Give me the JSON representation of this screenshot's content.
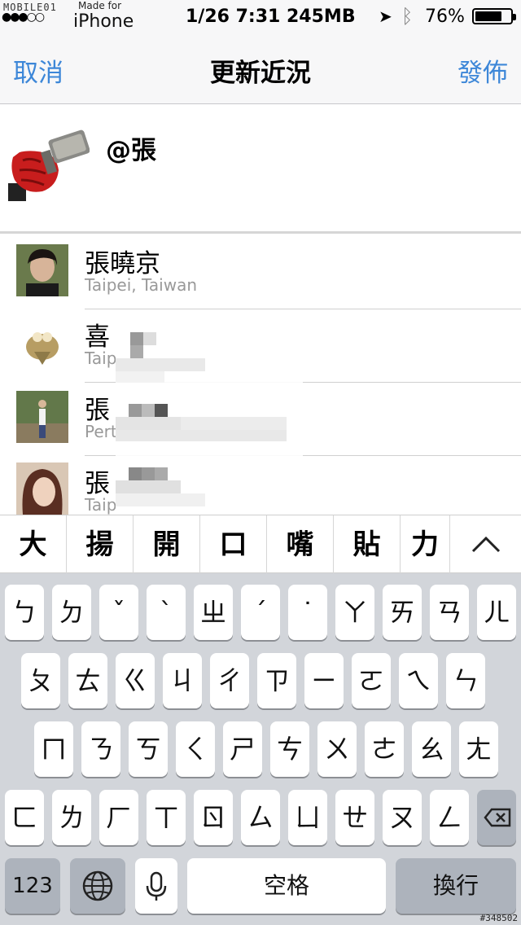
{
  "status_bar": {
    "logo": "MOBILE01",
    "made_for": "Made for",
    "device": "iPhone",
    "datetime_memory": "1/26 7:31 245MB",
    "battery_percent": "76%",
    "battery_level": 0.76
  },
  "nav": {
    "cancel": "取消",
    "title": "更新近況",
    "post": "發佈"
  },
  "compose": {
    "text": "@張"
  },
  "suggestions": [
    {
      "name": "張曉京",
      "location": "Taipei, Taiwan"
    },
    {
      "name": "喜",
      "location": "Taip"
    },
    {
      "name": "張",
      "location": "Pert"
    },
    {
      "name": "張",
      "location": "Taip"
    }
  ],
  "candidates": [
    "大",
    "揚",
    "開",
    "口",
    "嘴",
    "貼",
    "力"
  ],
  "candidate_expand_icon": "chevron-up-icon",
  "keyboard": {
    "row1": [
      "ㄅ",
      "ㄉ",
      "ˇ",
      "ˋ",
      "ㄓ",
      "ˊ",
      "˙",
      "ㄚ",
      "ㄞ",
      "ㄢ",
      "ㄦ"
    ],
    "row2": [
      "ㄆ",
      "ㄊ",
      "ㄍ",
      "ㄐ",
      "ㄔ",
      "ㄗ",
      "ㄧ",
      "ㄛ",
      "ㄟ",
      "ㄣ"
    ],
    "row3": [
      "ㄇ",
      "ㄋ",
      "ㄎ",
      "ㄑ",
      "ㄕ",
      "ㄘ",
      "ㄨ",
      "ㄜ",
      "ㄠ",
      "ㄤ"
    ],
    "row4": [
      "ㄈ",
      "ㄌ",
      "ㄏ",
      "ㄒ",
      "ㄖ",
      "ㄙ",
      "ㄩ",
      "ㄝ",
      "ㄡ",
      "ㄥ"
    ],
    "numbers": "123",
    "space": "空格",
    "return": "換行",
    "delete_icon": "backspace-icon",
    "globe_icon": "globe-icon",
    "mic_icon": "microphone-icon"
  },
  "watermark": "#348502"
}
